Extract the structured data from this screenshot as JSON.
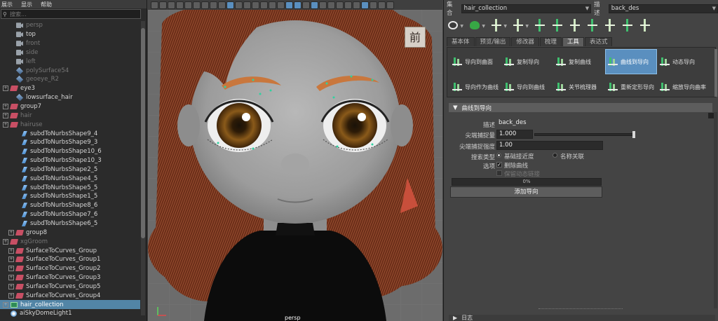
{
  "outliner": {
    "menu": [
      "展示",
      "显示",
      "帮助"
    ],
    "search_placeholder": "搜索...",
    "items": [
      {
        "label": "persp",
        "icon": "camera-icon",
        "dim": true,
        "expand": false,
        "indent": 1
      },
      {
        "label": "top",
        "icon": "camera-icon",
        "dim": false,
        "expand": false,
        "indent": 1
      },
      {
        "label": "front",
        "icon": "camera-icon",
        "dim": true,
        "expand": false,
        "indent": 1
      },
      {
        "label": "side",
        "icon": "camera-icon",
        "dim": true,
        "expand": false,
        "indent": 1
      },
      {
        "label": "left",
        "icon": "camera-icon",
        "dim": true,
        "expand": false,
        "indent": 1
      },
      {
        "label": "polySurface54",
        "icon": "mesh-icon",
        "dim": true,
        "expand": false,
        "indent": 1
      },
      {
        "label": "geoeye_R2",
        "icon": "mesh-icon",
        "dim": true,
        "expand": false,
        "indent": 1
      },
      {
        "label": "eye3",
        "icon": "group-icon",
        "dim": false,
        "expand": true,
        "indent": 0
      },
      {
        "label": "lowsurface_hair",
        "icon": "mesh-icon",
        "dim": false,
        "expand": false,
        "indent": 1
      },
      {
        "label": "group7",
        "icon": "group-icon",
        "dim": false,
        "expand": true,
        "indent": 0
      },
      {
        "label": "hair",
        "icon": "group-icon",
        "dim": true,
        "expand": true,
        "indent": 0
      },
      {
        "label": "hairuse",
        "icon": "group-icon",
        "dim": true,
        "expand": true,
        "indent": 0
      },
      {
        "label": "subdToNurbsShape9_4",
        "icon": "curve-shape-icon",
        "dim": false,
        "expand": false,
        "indent": 2
      },
      {
        "label": "subdToNurbsShape9_3",
        "icon": "curve-shape-icon",
        "dim": false,
        "expand": false,
        "indent": 2
      },
      {
        "label": "subdToNurbsShape10_6",
        "icon": "curve-shape-icon",
        "dim": false,
        "expand": false,
        "indent": 2
      },
      {
        "label": "subdToNurbsShape10_3",
        "icon": "curve-shape-icon",
        "dim": false,
        "expand": false,
        "indent": 2
      },
      {
        "label": "subdToNurbsShape2_5",
        "icon": "curve-shape-icon",
        "dim": false,
        "expand": false,
        "indent": 2
      },
      {
        "label": "subdToNurbsShape4_5",
        "icon": "curve-shape-icon",
        "dim": false,
        "expand": false,
        "indent": 2
      },
      {
        "label": "subdToNurbsShape5_5",
        "icon": "curve-shape-icon",
        "dim": false,
        "expand": false,
        "indent": 2
      },
      {
        "label": "subdToNurbsShape1_5",
        "icon": "curve-shape-icon",
        "dim": false,
        "expand": false,
        "indent": 2
      },
      {
        "label": "subdToNurbsShape8_6",
        "icon": "curve-shape-icon",
        "dim": false,
        "expand": false,
        "indent": 2
      },
      {
        "label": "subdToNurbsShape7_6",
        "icon": "curve-shape-icon",
        "dim": false,
        "expand": false,
        "indent": 2
      },
      {
        "label": "subdToNurbsShape6_5",
        "icon": "curve-shape-icon",
        "dim": false,
        "expand": false,
        "indent": 2
      },
      {
        "label": "group8",
        "icon": "group-icon",
        "dim": false,
        "expand": true,
        "indent": 1
      },
      {
        "label": "xgGroom",
        "icon": "group-icon",
        "dim": true,
        "expand": true,
        "indent": 0
      },
      {
        "label": "SurfaceToCurves_Group",
        "icon": "group-icon",
        "dim": false,
        "expand": true,
        "indent": 1
      },
      {
        "label": "SurfaceToCurves_Group1",
        "icon": "group-icon",
        "dim": false,
        "expand": true,
        "indent": 1
      },
      {
        "label": "SurfaceToCurves_Group2",
        "icon": "group-icon",
        "dim": false,
        "expand": true,
        "indent": 1
      },
      {
        "label": "SurfaceToCurves_Group3",
        "icon": "group-icon",
        "dim": false,
        "expand": true,
        "indent": 1
      },
      {
        "label": "SurfaceToCurves_Group5",
        "icon": "group-icon",
        "dim": false,
        "expand": true,
        "indent": 1
      },
      {
        "label": "SurfaceToCurves_Group4",
        "icon": "group-icon",
        "dim": false,
        "expand": true,
        "indent": 1
      },
      {
        "label": "hair_collection",
        "icon": "collection-icon",
        "dim": false,
        "expand": true,
        "indent": 0,
        "selected": true
      },
      {
        "label": "aiSkyDomeLight1",
        "icon": "light-icon",
        "dim": false,
        "expand": false,
        "indent": 0
      }
    ]
  },
  "viewport": {
    "camera_label": "persp",
    "badge_text": "前"
  },
  "xgen": {
    "collection_label": "集合",
    "collection_value": "hair_collection",
    "description_label": "描述",
    "description_value": "back_des",
    "tabs": [
      "基本体",
      "预览/输出",
      "修改器",
      "梳理",
      "工具",
      "表达式"
    ],
    "active_tab": "工具",
    "tools": [
      {
        "label": "导向到曲面",
        "active": false
      },
      {
        "label": "复制导向",
        "active": false
      },
      {
        "label": "复制曲线",
        "active": false
      },
      {
        "label": "曲线到导向",
        "active": true
      },
      {
        "label": "动态导向",
        "active": false
      },
      {
        "label": "导向作为曲线",
        "active": false
      },
      {
        "label": "导向到曲线",
        "active": false
      },
      {
        "label": "关节梳理器",
        "active": false
      },
      {
        "label": "重新定形导向",
        "active": false
      },
      {
        "label": "缩放导向曲率",
        "active": false
      }
    ],
    "section_title": "曲线到导向",
    "form": {
      "desc_label": "描述",
      "desc_value": "back_des",
      "tip_snap_label": "尖端捕捉量",
      "tip_snap_value": "1.000",
      "tip_snap_fraction": 1.0,
      "tip_snap_strength_label": "尖端捕捉强度",
      "tip_snap_strength_value": "1.00",
      "search_type_label": "搜索类型",
      "search_opt1": "基础接近度",
      "search_opt2": "名称关联",
      "options_label": "选项",
      "delete_curves_label": "删除曲线",
      "keep_anim_label": "保留动态链接",
      "progress_text": "0%",
      "progress_fraction": 0,
      "add_button": "添加导向"
    },
    "log_label": "日志"
  }
}
